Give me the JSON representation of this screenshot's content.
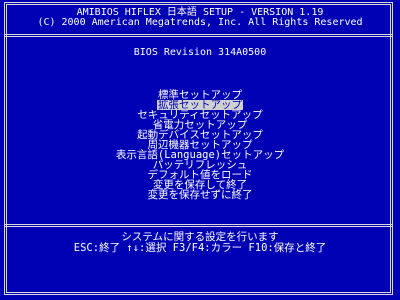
{
  "header": {
    "title": "AMIBIOS HIFLEX 日本語 SETUP - VERSION  1.19",
    "copyright": "(C) 2000 American Megatrends, Inc. All Rights Reserved"
  },
  "bios_revision": "BIOS Revision 314A0500",
  "menu": {
    "items": [
      {
        "label": "標準セットアップ",
        "selected": false
      },
      {
        "label": "拡張セットアップ",
        "selected": true
      },
      {
        "label": "セキュリティセットアップ",
        "selected": false
      },
      {
        "label": "省電力セットアップ",
        "selected": false
      },
      {
        "label": "起動デバイスセットアップ",
        "selected": false
      },
      {
        "label": "周辺機器セットアップ",
        "selected": false
      },
      {
        "label": "表示言語(Language)セットアップ",
        "selected": false
      },
      {
        "label": "パッテリフレッシュ",
        "selected": false
      },
      {
        "label": "デフォルト値をロード",
        "selected": false
      },
      {
        "label": "変更を保存して終了",
        "selected": false
      },
      {
        "label": "変更を保存せずに終了",
        "selected": false
      }
    ]
  },
  "footer": {
    "description": "システムに関する設定を行います",
    "keys": "ESC:終了  ↑↓:選択  F3/F4:カラー  F10:保存と終了"
  },
  "colors": {
    "background": "#0000b4",
    "text": "#ffffff",
    "highlight_bg": "#d0d0d0",
    "highlight_text": "#0000b4"
  }
}
